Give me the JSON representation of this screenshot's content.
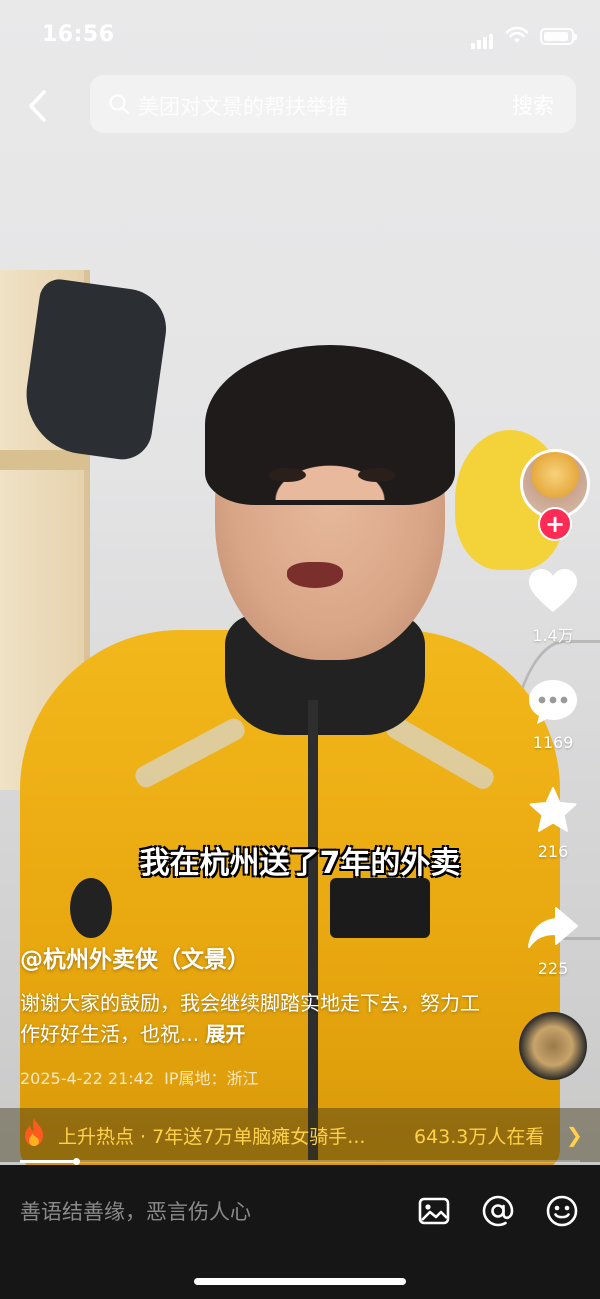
{
  "status_bar": {
    "time": "16:56"
  },
  "search": {
    "query": "美团对文景的帮扶举措",
    "button_label": "搜索"
  },
  "subtitle": "我在杭州送了7年的外卖",
  "video": {
    "author": "@杭州外卖侠（文景）",
    "description": "谢谢大家的鼓励，我会继续脚踏实地走下去，努力工作好好生活，也祝...",
    "expand_label": "展开",
    "date": "2025-4-22 21:42",
    "ip_location": "IP属地：浙江",
    "progress": 0.1
  },
  "actions": {
    "likes": "1.4万",
    "comments": "1169",
    "favorites": "216",
    "shares": "225"
  },
  "hot": {
    "text": "上升热点 · 7年送7万单脑瘫女骑手...",
    "viewers": "643.3万人在看"
  },
  "comment_bar": {
    "placeholder": "善语结善缘，恶言伤人心"
  },
  "colors": {
    "follow": "#fe2c55",
    "hot_text": "#ffd24a",
    "bottom_bar": "#161616"
  },
  "icons": [
    "back-icon",
    "search-icon",
    "heart-icon",
    "comment-icon",
    "star-icon",
    "share-icon",
    "fire-icon",
    "image-icon",
    "at-icon",
    "emoji-icon"
  ]
}
